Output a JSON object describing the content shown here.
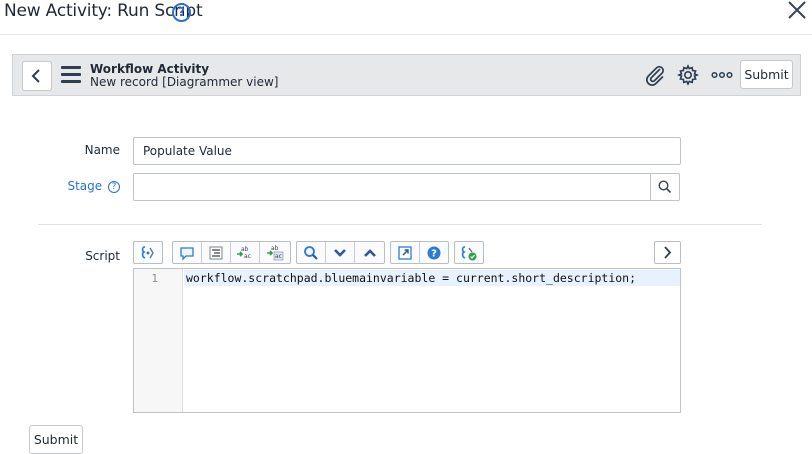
{
  "dialog": {
    "title": "New Activity: Run Script",
    "help_icon": "question-circle-icon",
    "close_icon": "close-icon"
  },
  "header": {
    "title": "Workflow Activity",
    "subtitle": "New record [Diagrammer view]",
    "back_icon": "chevron-left-icon",
    "menu_icon": "hamburger-menu-icon",
    "attachment_icon": "paperclip-icon",
    "settings_icon": "gear-icon",
    "more_icon": "more-options-icon",
    "submit_label": "Submit"
  },
  "form": {
    "name_label": "Name",
    "name_value": "Populate Value",
    "stage_label": "Stage",
    "stage_help": "?",
    "stage_value": "",
    "stage_lookup_icon": "search-icon",
    "script_label": "Script"
  },
  "toolbar": {
    "groups": [
      [
        "script-include-icon"
      ],
      [
        "comment-icon",
        "format-code-icon",
        "replace-icon",
        "replace-all-icon"
      ],
      [
        "search-icon",
        "toggle-down-icon",
        "toggle-up-icon"
      ],
      [
        "fullscreen-icon",
        "help-icon"
      ],
      [
        "script-debug-icon"
      ]
    ],
    "expand_icon": "chevron-right-icon"
  },
  "editor": {
    "lines": [
      {
        "number": "1",
        "code": "workflow.scratchpad.bluemainvariable = current.short_description;"
      }
    ]
  },
  "footer": {
    "submit_label": "Submit"
  },
  "colors": {
    "accent": "#2a6fd6",
    "header_bg": "#e6e8ea",
    "active_line_bg": "#e8f2fe"
  }
}
